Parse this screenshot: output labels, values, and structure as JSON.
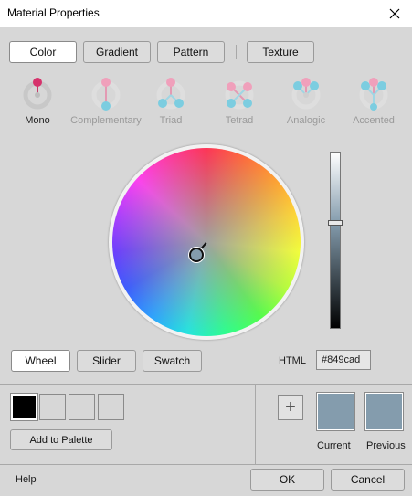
{
  "window": {
    "title": "Material Properties"
  },
  "tabs": [
    {
      "label": "Color",
      "active": true
    },
    {
      "label": "Gradient",
      "active": false
    },
    {
      "label": "Pattern",
      "active": false
    },
    {
      "label": "Texture",
      "active": false
    }
  ],
  "harmonies": [
    {
      "label": "Mono",
      "selected": true,
      "icon": "mono-icon"
    },
    {
      "label": "Complementary",
      "selected": false,
      "icon": "complementary-icon"
    },
    {
      "label": "Triad",
      "selected": false,
      "icon": "triad-icon"
    },
    {
      "label": "Tetrad",
      "selected": false,
      "icon": "tetrad-icon"
    },
    {
      "label": "Analogic",
      "selected": false,
      "icon": "analogic-icon"
    },
    {
      "label": "Accented",
      "selected": false,
      "icon": "accented-icon"
    }
  ],
  "modes": [
    {
      "label": "Wheel",
      "active": true
    },
    {
      "label": "Slider",
      "active": false
    },
    {
      "label": "Swatch",
      "active": false
    }
  ],
  "html_color": {
    "label": "HTML",
    "value": "#849cad"
  },
  "palette": {
    "add_label": "Add to Palette",
    "add_color_symbol": "+"
  },
  "current": {
    "label": "Current",
    "color": "#849cad"
  },
  "previous": {
    "label": "Previous",
    "color": "#849cad"
  },
  "footer": {
    "help": "Help",
    "ok": "OK",
    "cancel": "Cancel"
  },
  "colors": {
    "selected_accent": "#d6336c",
    "inactive_accent": "#f0a0bb",
    "secondary_dot": "#7ccde0",
    "background": "#d7d7d7"
  }
}
